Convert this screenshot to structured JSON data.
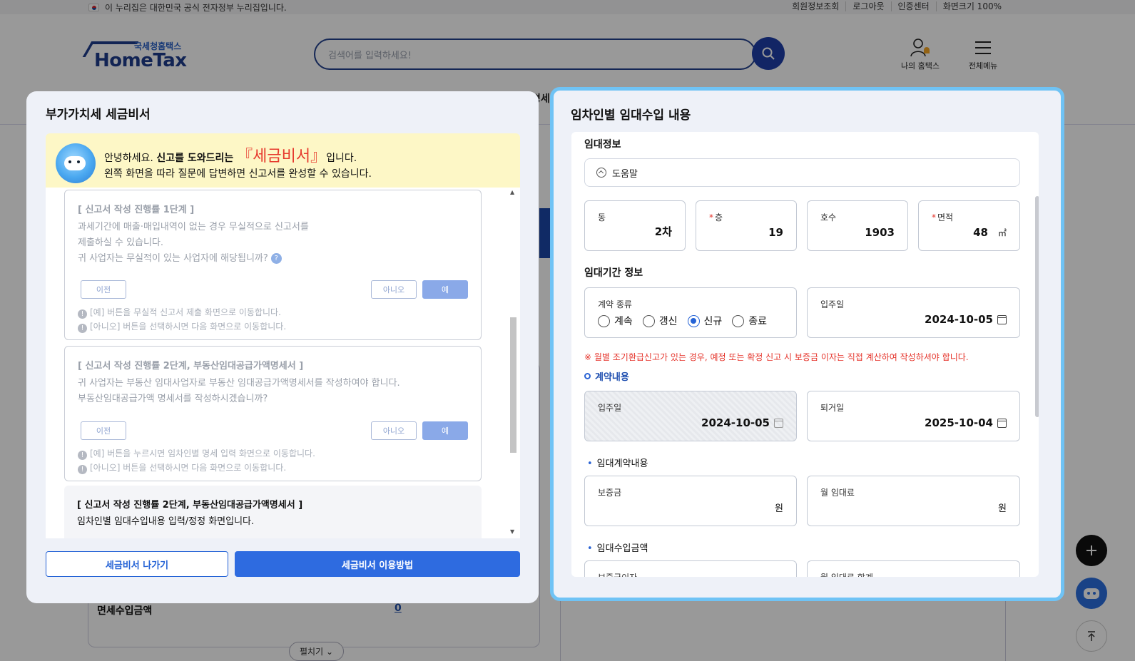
{
  "gov_bar": {
    "notice": "이 누리집은 대한민국 공식 전자정부 누리집입니다.",
    "links": [
      "회원정보조회",
      "로그아웃",
      "인증센터",
      "화면크기 100%"
    ]
  },
  "header": {
    "logo_sub": "국세청홈택스",
    "logo_main": "HomeTax",
    "search_placeholder": "검색어를 입력하세요!",
    "my_hometax": "나의 홈택스",
    "all_menu": "전체메뉴"
  },
  "background": {
    "partial_text": "명세·",
    "row_label": "면세수입금액",
    "row_value": "0",
    "expand_label": "펼치기"
  },
  "left_modal": {
    "title": "부가가치세 세금비서",
    "greeting": {
      "hello": "안녕하세요. ",
      "bold": "신고를 도와드리는 ",
      "name_open": "『",
      "name": "세금비서",
      "name_close": "』",
      "tail": "입니다.",
      "line2": "왼쪽 화면을 따라 질문에 답변하면 신고서를 완성할 수 있습니다."
    },
    "step1": {
      "title": "[ 신고서 작성 진행률 1단계 ]",
      "body1": "과세기간에 매출·매입내역이 없는 경우 무실적으로 신고서를",
      "body2": "제출하실 수 있습니다.",
      "body3": "귀 사업자는 무실적이 있는 사업자에 해당됩니까?",
      "prev": "이전",
      "no": "아니오",
      "yes": "예",
      "note1": "[예] 버튼을 무실적 신고서 제출 화면으로 이동합니다.",
      "note2": "[아니오] 버튼을 선택하시면 다음 화면으로 이동합니다."
    },
    "step2": {
      "title": "[ 신고서 작성 진행률 2단계, 부동산임대공급가액명세서 ]",
      "body1": "귀 사업자는 부동산 임대사업자로 부동산 임대공급가액명세서를 작성하여야 합니다.",
      "body2": "부동산임대공급가액 명세서를 작성하시겠습니까?",
      "prev": "이전",
      "no": "아니오",
      "yes": "예",
      "note1": "[예] 버튼을 누르시면 임차인별 명세 입력 화면으로 이동합니다.",
      "note2": "[아니오] 버튼을 선택하시면 다음 화면으로 이동합니다."
    },
    "step3": {
      "title": "[ 신고서 작성 진행률 2단계, 부동산임대공급가액명세서 ]",
      "body1": "임차인별 임대수입내용 입력/정정 화면입니다."
    },
    "btn_exit": "세금비서 나가기",
    "btn_howto": "세금비서 이용방법"
  },
  "right_modal": {
    "title": "임차인별 임대수입 내용",
    "lease_info": "임대정보",
    "help": "도움말",
    "dong": {
      "label": "동",
      "value": "2차"
    },
    "floor": {
      "label": "층",
      "value": "19"
    },
    "ho": {
      "label": "호수",
      "value": "1903"
    },
    "area": {
      "label": "면적",
      "value": "48",
      "unit": "㎡"
    },
    "period_info": "임대기간 정보",
    "contract_type": {
      "label": "계약 종류",
      "options": [
        "계속",
        "갱신",
        "신규",
        "종료"
      ],
      "selected": "신규"
    },
    "move_in_top": {
      "label": "입주일",
      "value": "2024-10-05"
    },
    "warning": "※ 월별 조기환급신고가 있는 경우, 예정 또는 확정 신고 시 보증금 이자는 직접 계산하여 작성하셔야 합니다.",
    "contract_content": "계약내용",
    "move_in": {
      "label": "입주일",
      "value": "2024-10-05"
    },
    "move_out": {
      "label": "퇴거일",
      "value": "2025-10-04"
    },
    "lease_contract": "임대계약내용",
    "deposit": {
      "label": "보증금",
      "unit": "원"
    },
    "monthly_rent": {
      "label": "월 임대료",
      "unit": "원"
    },
    "lease_income": "임대수입금액",
    "deposit_interest": {
      "label": "보증금이자"
    },
    "rent_total": {
      "label": "월 임대료 합계"
    }
  },
  "colors": {
    "primary": "#2e6be0",
    "accent_red": "#e5332a",
    "modal_border": "#6fc3f5"
  }
}
